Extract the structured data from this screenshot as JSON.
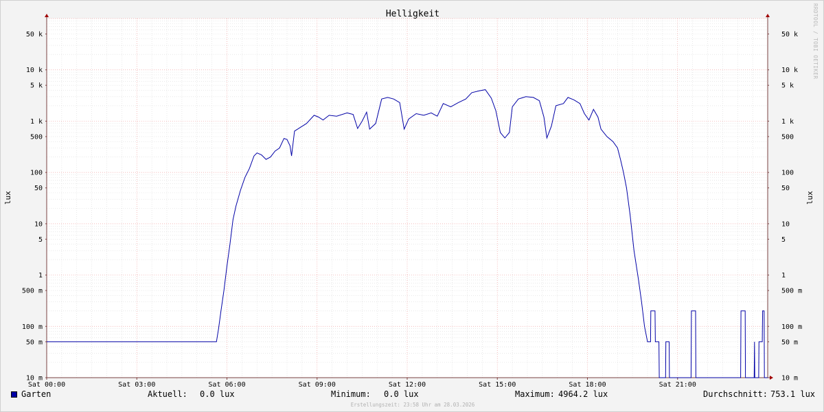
{
  "chart_data": {
    "type": "line",
    "title": "Helligkeit",
    "ylabel": "lux",
    "y_scale": "log",
    "ylim": [
      0.01,
      100000
    ],
    "xlim": [
      "Sat 00:00",
      "Sat 24:00"
    ],
    "grid": true,
    "y_ticks": [
      {
        "value": 0.01,
        "label": "10 m"
      },
      {
        "value": 0.05,
        "label": "50 m"
      },
      {
        "value": 0.1,
        "label": "100 m"
      },
      {
        "value": 0.5,
        "label": "500 m"
      },
      {
        "value": 1,
        "label": "1"
      },
      {
        "value": 5,
        "label": "5"
      },
      {
        "value": 10,
        "label": "10"
      },
      {
        "value": 50,
        "label": "50"
      },
      {
        "value": 100,
        "label": "100"
      },
      {
        "value": 500,
        "label": "500"
      },
      {
        "value": 1000,
        "label": "1 k"
      },
      {
        "value": 5000,
        "label": "5 k"
      },
      {
        "value": 10000,
        "label": "10 k"
      },
      {
        "value": 50000,
        "label": "50 k"
      }
    ],
    "x_ticks": [
      {
        "hour": 0,
        "label": "Sat 00:00"
      },
      {
        "hour": 3,
        "label": "Sat 03:00"
      },
      {
        "hour": 6,
        "label": "Sat 06:00"
      },
      {
        "hour": 9,
        "label": "Sat 09:00"
      },
      {
        "hour": 12,
        "label": "Sat 12:00"
      },
      {
        "hour": 15,
        "label": "Sat 15:00"
      },
      {
        "hour": 18,
        "label": "Sat 18:00"
      },
      {
        "hour": 21,
        "label": "Sat 21:00"
      }
    ],
    "series": [
      {
        "name": "Garten",
        "color": "#0000a6",
        "points": [
          [
            0.0,
            0.05
          ],
          [
            5.65,
            0.05
          ],
          [
            5.72,
            0.09
          ],
          [
            5.8,
            0.2
          ],
          [
            5.9,
            0.5
          ],
          [
            6.0,
            1.5
          ],
          [
            6.1,
            4
          ],
          [
            6.2,
            12
          ],
          [
            6.3,
            22
          ],
          [
            6.45,
            45
          ],
          [
            6.6,
            80
          ],
          [
            6.75,
            120
          ],
          [
            6.9,
            210
          ],
          [
            7.0,
            240
          ],
          [
            7.15,
            220
          ],
          [
            7.3,
            180
          ],
          [
            7.45,
            200
          ],
          [
            7.6,
            260
          ],
          [
            7.75,
            300
          ],
          [
            7.9,
            460
          ],
          [
            8.0,
            440
          ],
          [
            8.1,
            330
          ],
          [
            8.15,
            210
          ],
          [
            8.25,
            640
          ],
          [
            8.45,
            760
          ],
          [
            8.65,
            900
          ],
          [
            8.9,
            1300
          ],
          [
            9.05,
            1200
          ],
          [
            9.2,
            1050
          ],
          [
            9.4,
            1300
          ],
          [
            9.65,
            1250
          ],
          [
            10.0,
            1450
          ],
          [
            10.2,
            1350
          ],
          [
            10.35,
            720
          ],
          [
            10.5,
            1000
          ],
          [
            10.65,
            1500
          ],
          [
            10.75,
            700
          ],
          [
            10.95,
            900
          ],
          [
            11.15,
            2700
          ],
          [
            11.35,
            2900
          ],
          [
            11.55,
            2700
          ],
          [
            11.75,
            2300
          ],
          [
            11.9,
            700
          ],
          [
            12.05,
            1100
          ],
          [
            12.3,
            1400
          ],
          [
            12.55,
            1300
          ],
          [
            12.8,
            1450
          ],
          [
            13.0,
            1250
          ],
          [
            13.2,
            2200
          ],
          [
            13.45,
            1900
          ],
          [
            13.7,
            2300
          ],
          [
            13.95,
            2700
          ],
          [
            14.15,
            3600
          ],
          [
            14.4,
            3900
          ],
          [
            14.6,
            4100
          ],
          [
            14.8,
            2800
          ],
          [
            14.95,
            1600
          ],
          [
            15.1,
            600
          ],
          [
            15.25,
            470
          ],
          [
            15.4,
            600
          ],
          [
            15.5,
            1900
          ],
          [
            15.7,
            2700
          ],
          [
            15.95,
            3000
          ],
          [
            16.2,
            2900
          ],
          [
            16.4,
            2500
          ],
          [
            16.55,
            1200
          ],
          [
            16.65,
            470
          ],
          [
            16.8,
            800
          ],
          [
            16.95,
            2000
          ],
          [
            17.2,
            2200
          ],
          [
            17.35,
            2900
          ],
          [
            17.55,
            2600
          ],
          [
            17.75,
            2200
          ],
          [
            17.9,
            1400
          ],
          [
            18.05,
            1050
          ],
          [
            18.2,
            1700
          ],
          [
            18.35,
            1200
          ],
          [
            18.45,
            700
          ],
          [
            18.65,
            500
          ],
          [
            18.85,
            400
          ],
          [
            19.0,
            300
          ],
          [
            19.1,
            180
          ],
          [
            19.2,
            100
          ],
          [
            19.3,
            50
          ],
          [
            19.42,
            15
          ],
          [
            19.55,
            3
          ],
          [
            19.7,
            0.8
          ],
          [
            19.8,
            0.3
          ],
          [
            19.9,
            0.1
          ],
          [
            20.0,
            0.05
          ],
          [
            20.1,
            0.05
          ],
          [
            20.11,
            0.2
          ],
          [
            20.25,
            0.2
          ],
          [
            20.26,
            0.05
          ],
          [
            20.38,
            0.05
          ],
          [
            20.39,
            0.01
          ],
          [
            20.6,
            0.01
          ],
          [
            20.61,
            0.05
          ],
          [
            20.72,
            0.05
          ],
          [
            20.73,
            0.01
          ],
          [
            21.45,
            0.01
          ],
          [
            21.46,
            0.2
          ],
          [
            21.6,
            0.2
          ],
          [
            21.61,
            0.01
          ],
          [
            23.1,
            0.01
          ],
          [
            23.11,
            0.2
          ],
          [
            23.25,
            0.2
          ],
          [
            23.26,
            0.01
          ],
          [
            23.55,
            0.01
          ],
          [
            23.56,
            0.05
          ],
          [
            23.57,
            0.01
          ],
          [
            23.7,
            0.01
          ],
          [
            23.71,
            0.05
          ],
          [
            23.82,
            0.05
          ],
          [
            23.83,
            0.2
          ],
          [
            23.88,
            0.2
          ],
          [
            23.89,
            0.01
          ],
          [
            24.0,
            0.01
          ]
        ]
      }
    ]
  },
  "legend": {
    "series_name": "Garten",
    "aktuell_label": "Aktuell:",
    "aktuell_value": "0.0 lux",
    "minimum_label": "Minimum:",
    "minimum_value": "0.0 lux",
    "maximum_label": "Maximum:",
    "maximum_value": "4964.2 lux",
    "durchschnitt_label": "Durchschnitt:",
    "durchschnitt_value": "753.1 lux"
  },
  "footer": "Erstellungszeit: 23:58 Uhr am 28.03.2026",
  "credit": "RRDTOOL / TOBI OETIKER"
}
